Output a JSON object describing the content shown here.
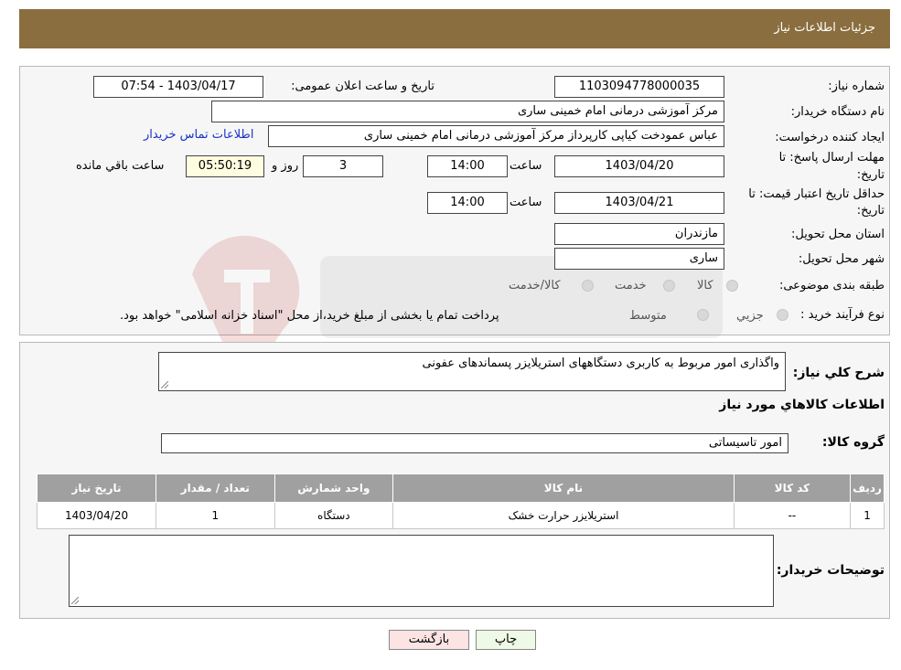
{
  "header": {
    "title": "جزئیات اطلاعات نیاز"
  },
  "form": {
    "need_number_label": "شماره نیاز:",
    "need_number": "1103094778000035",
    "announce_label": "تاریخ و ساعت اعلان عمومی:",
    "announce_value": "1403/04/17 - 07:54",
    "buyer_org_label": "نام دستگاه خریدار:",
    "buyer_org": "مرکز آموزشی درمانی امام خمینی ساری",
    "creator_label": "ایجاد کننده درخواست:",
    "creator": "عباس عمودخت کیاپی کارپرداز مرکز آموزشی درمانی امام خمینی ساری",
    "contact_link": "اطلاعات تماس خریدار",
    "deadline_label_1": "مهلت ارسال پاسخ: تا",
    "deadline_label_2": "تاریخ:",
    "deadline_date": "1403/04/20",
    "time_label": "ساعت",
    "deadline_time": "14:00",
    "days_value": "3",
    "days_label": "روز و",
    "remaining_value": "05:50:19",
    "remaining_label": "ساعت باقي مانده",
    "validity_label_1": "حداقل تاريخ اعتبار قيمت: تا",
    "validity_label_2": "تاريخ:",
    "validity_date": "1403/04/21",
    "validity_time": "14:00",
    "province_label": "استان محل تحویل:",
    "province": "مازندران",
    "city_label": "شهر محل تحویل:",
    "city": "ساری",
    "category_label": "طبقه بندی موضوعی:",
    "category_options": [
      "کالا",
      "خدمت",
      "کالا/خدمت"
    ],
    "process_label": "نوع فرآیند خرید :",
    "process_options": [
      "جزيي",
      "متوسط"
    ],
    "process_note": "پرداخت تمام یا بخشی از مبلغ خرید،از محل \"اسناد خزانه اسلامی\" خواهد بود."
  },
  "details": {
    "description_label": "شرح کلي نياز:",
    "description": "واگذاری امور مربوط به کاربری دستگاههای استریلایزر پسماندهای عفونی",
    "goods_info_title": "اطلاعات کالاهاي مورد نياز",
    "goods_group_label": "گروه کالا:",
    "goods_group": "امور تاسیساتی",
    "table": {
      "headers": [
        "ردیف",
        "کد کالا",
        "نام کالا",
        "واحد شمارش",
        "تعداد / مقدار",
        "تاریخ نیاز"
      ],
      "rows": [
        [
          "1",
          "--",
          "استریلایزر حرارت خشک",
          "دستگاه",
          "1",
          "1403/04/20"
        ]
      ]
    },
    "buyer_notes_label": "توضیحات خریدار:",
    "buyer_notes": ""
  },
  "buttons": {
    "print": "چاپ",
    "back": "بازگشت"
  }
}
